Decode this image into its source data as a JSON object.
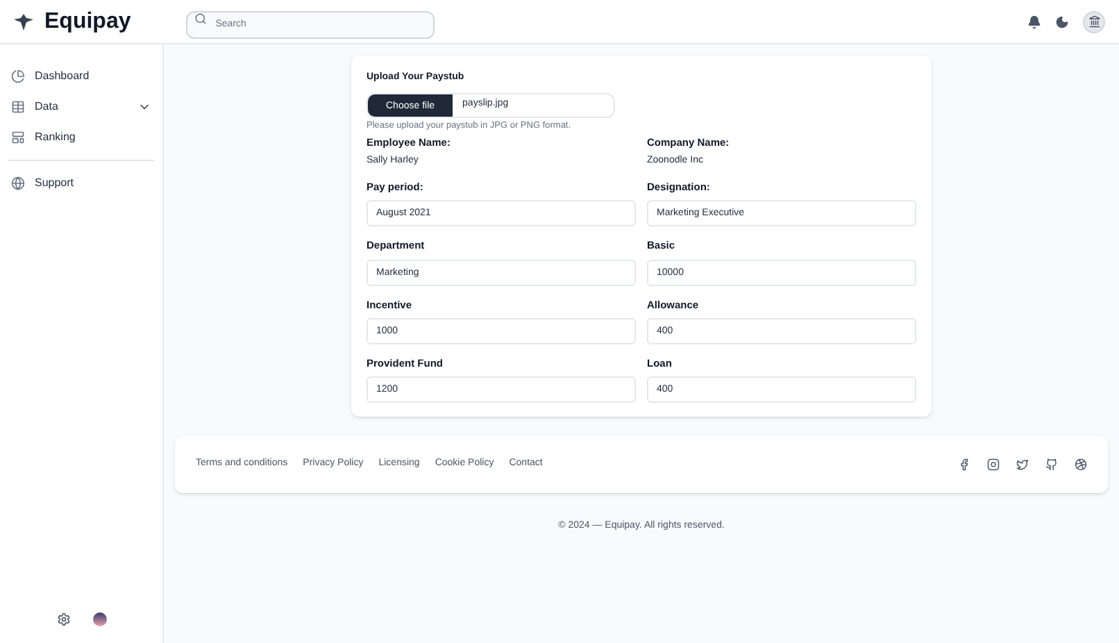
{
  "header": {
    "brand": "Equipay",
    "search": {
      "placeholder": "Search"
    }
  },
  "sidebar": {
    "items": [
      {
        "label": "Dashboard",
        "expandable": false
      },
      {
        "label": "Data",
        "expandable": true
      },
      {
        "label": "Ranking",
        "expandable": false
      },
      {
        "label": "Support",
        "expandable": false
      }
    ]
  },
  "upload": {
    "label": "Upload Your Paystub",
    "button": "Choose file",
    "filename": "payslip.jpg",
    "hint": "Please upload your paystub in JPG or PNG format."
  },
  "fields": [
    {
      "kind": "static",
      "label": "Employee Name:",
      "value": "Sally Harley"
    },
    {
      "kind": "static",
      "label": "Company Name:",
      "value": "Zoonodle Inc"
    },
    {
      "kind": "input",
      "label": "Pay period:",
      "value": "August 2021"
    },
    {
      "kind": "input",
      "label": "Designation:",
      "value": "Marketing Executive"
    },
    {
      "kind": "input",
      "label": "Department",
      "value": "Marketing"
    },
    {
      "kind": "input",
      "label": "Basic",
      "value": "10000"
    },
    {
      "kind": "input",
      "label": "Incentive",
      "value": "1000"
    },
    {
      "kind": "input",
      "label": "Allowance",
      "value": "400"
    },
    {
      "kind": "input",
      "label": "Provident Fund",
      "value": "1200"
    },
    {
      "kind": "input",
      "label": "Loan",
      "value": "400"
    }
  ],
  "footer": {
    "links": [
      "Terms and conditions",
      "Privacy Policy",
      "Licensing",
      "Cookie Policy",
      "Contact"
    ],
    "copyright": "© 2024 — Equipay. All rights reserved."
  }
}
